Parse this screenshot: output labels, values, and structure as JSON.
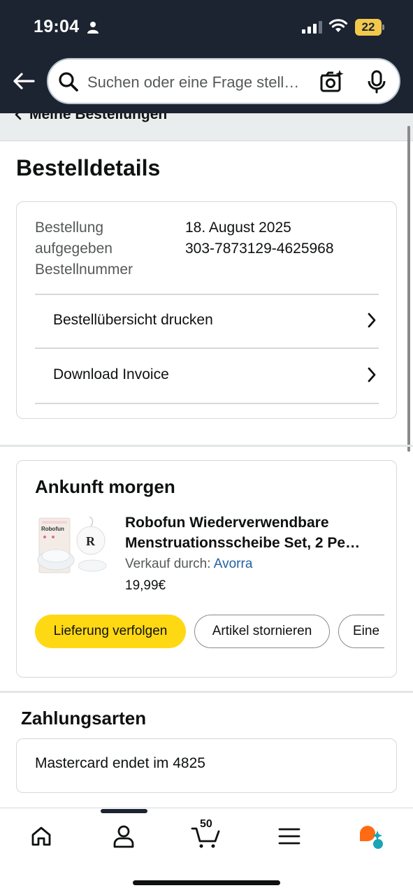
{
  "status_bar": {
    "time": "19:04",
    "battery": "22"
  },
  "search": {
    "placeholder": "Suchen oder eine Frage stell…"
  },
  "breadcrumb": {
    "label": "Meine Bestellungen"
  },
  "page_title": "Bestelldetails",
  "order": {
    "label_lines": [
      "Bestellung",
      "aufgegeben",
      "Bestellnummer"
    ],
    "date": "18. August 2025",
    "number": "303-7873129-4625968",
    "links": [
      {
        "label": "Bestellübersicht drucken"
      },
      {
        "label": "Download Invoice"
      }
    ]
  },
  "arrival": {
    "title": "Ankunft morgen",
    "product_title_line1": "Robofun Wiederverwendbare",
    "product_title_line2": "Menstruationsscheibe Set, 2 Pe…",
    "seller_prefix": "Verkauf durch:",
    "seller_name": "Avorra",
    "price": "19,99€",
    "product_image_brand": "Robofun",
    "product_image_mark": "R",
    "buttons": {
      "track": "Lieferung verfolgen",
      "cancel": "Artikel stornieren",
      "more": "Eine"
    }
  },
  "payment": {
    "title": "Zahlungsarten",
    "method": "Mastercard",
    "ending": "endet im 4825"
  },
  "bottom_nav": {
    "items": [
      "home-icon",
      "account-icon",
      "cart-icon",
      "menu-icon",
      "ai-assistant-icon"
    ],
    "cart_count": "50"
  },
  "colors": {
    "header_bg": "#1c2331",
    "primary_button": "#ffd814",
    "link": "#2162a1",
    "battery": "#f2c94c",
    "assistant_orange": "#ff6a13",
    "assistant_teal": "#1aa5b6"
  }
}
